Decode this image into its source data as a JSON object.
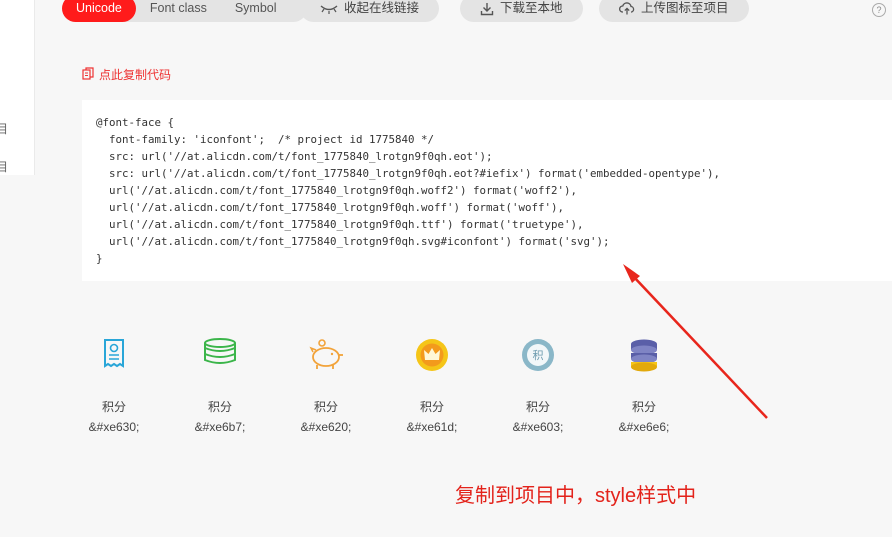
{
  "tabs": [
    {
      "label": "Unicode",
      "active": true
    },
    {
      "label": "Font class",
      "active": false
    },
    {
      "label": "Symbol",
      "active": false
    }
  ],
  "toolbar": {
    "collapse_label": "收起在线链接",
    "download_label": "下载至本地",
    "upload_label": "上传图标至项目",
    "help_glyph": "?"
  },
  "sidebar": {
    "glyph1": "目",
    "glyph2": "目"
  },
  "copy_code_label": "点此复制代码",
  "code_lines": [
    "@font-face {",
    "  font-family: 'iconfont';  /* project id 1775840 */",
    "  src: url('//at.alicdn.com/t/font_1775840_lrotgn9f0qh.eot');",
    "  src: url('//at.alicdn.com/t/font_1775840_lrotgn9f0qh.eot?#iefix') format('embedded-opentype'),",
    "  url('//at.alicdn.com/t/font_1775840_lrotgn9f0qh.woff2') format('woff2'),",
    "  url('//at.alicdn.com/t/font_1775840_lrotgn9f0qh.woff') format('woff'),",
    "  url('//at.alicdn.com/t/font_1775840_lrotgn9f0qh.ttf') format('truetype'),",
    "  url('//at.alicdn.com/t/font_1775840_lrotgn9f0qh.svg#iconfont') format('svg');",
    "}"
  ],
  "icons": [
    {
      "icon": "receipt-icon",
      "name": "积分",
      "code": "&#xe630;",
      "color": "#29a6d8"
    },
    {
      "icon": "coin-stack-icon",
      "name": "积分",
      "code": "&#xe6b7;",
      "color": "#3bb54a"
    },
    {
      "icon": "piggy-bank-icon",
      "name": "积分",
      "code": "&#xe620;",
      "color": "#f2a33a"
    },
    {
      "icon": "crown-coin-icon",
      "name": "积分",
      "code": "&#xe61d;",
      "color": "#f5c518"
    },
    {
      "icon": "points-badge-icon",
      "name": "积分",
      "code": "&#xe603;",
      "color": "#8ab7c8"
    },
    {
      "icon": "coin-pile-icon",
      "name": "积分",
      "code": "&#xe6e6;",
      "color": "#5a5fa8"
    }
  ],
  "annotation_text": "复制到项目中，style样式中",
  "colors": {
    "accent": "#ff1b1b",
    "annotation": "#e3231b"
  }
}
